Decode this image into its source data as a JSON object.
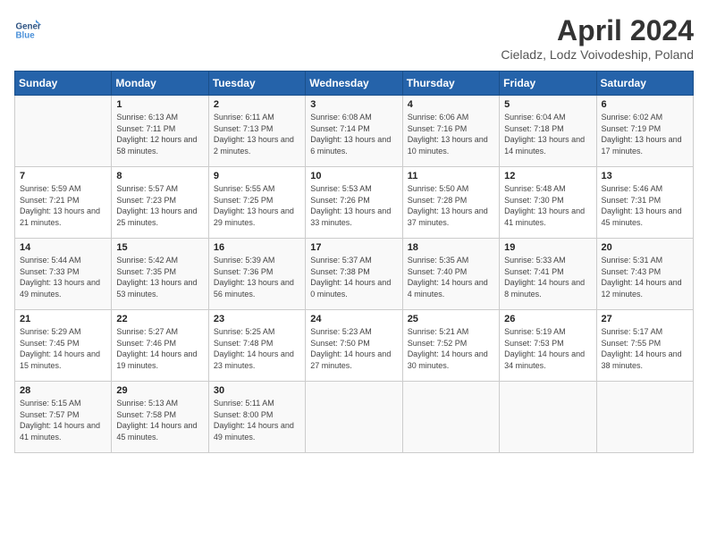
{
  "header": {
    "logo_line1": "General",
    "logo_line2": "Blue",
    "title": "April 2024",
    "location": "Cieladz, Lodz Voivodeship, Poland"
  },
  "days_of_week": [
    "Sunday",
    "Monday",
    "Tuesday",
    "Wednesday",
    "Thursday",
    "Friday",
    "Saturday"
  ],
  "weeks": [
    [
      {
        "day": "",
        "sunrise": "",
        "sunset": "",
        "daylight": ""
      },
      {
        "day": "1",
        "sunrise": "Sunrise: 6:13 AM",
        "sunset": "Sunset: 7:11 PM",
        "daylight": "Daylight: 12 hours and 58 minutes."
      },
      {
        "day": "2",
        "sunrise": "Sunrise: 6:11 AM",
        "sunset": "Sunset: 7:13 PM",
        "daylight": "Daylight: 13 hours and 2 minutes."
      },
      {
        "day": "3",
        "sunrise": "Sunrise: 6:08 AM",
        "sunset": "Sunset: 7:14 PM",
        "daylight": "Daylight: 13 hours and 6 minutes."
      },
      {
        "day": "4",
        "sunrise": "Sunrise: 6:06 AM",
        "sunset": "Sunset: 7:16 PM",
        "daylight": "Daylight: 13 hours and 10 minutes."
      },
      {
        "day": "5",
        "sunrise": "Sunrise: 6:04 AM",
        "sunset": "Sunset: 7:18 PM",
        "daylight": "Daylight: 13 hours and 14 minutes."
      },
      {
        "day": "6",
        "sunrise": "Sunrise: 6:02 AM",
        "sunset": "Sunset: 7:19 PM",
        "daylight": "Daylight: 13 hours and 17 minutes."
      }
    ],
    [
      {
        "day": "7",
        "sunrise": "Sunrise: 5:59 AM",
        "sunset": "Sunset: 7:21 PM",
        "daylight": "Daylight: 13 hours and 21 minutes."
      },
      {
        "day": "8",
        "sunrise": "Sunrise: 5:57 AM",
        "sunset": "Sunset: 7:23 PM",
        "daylight": "Daylight: 13 hours and 25 minutes."
      },
      {
        "day": "9",
        "sunrise": "Sunrise: 5:55 AM",
        "sunset": "Sunset: 7:25 PM",
        "daylight": "Daylight: 13 hours and 29 minutes."
      },
      {
        "day": "10",
        "sunrise": "Sunrise: 5:53 AM",
        "sunset": "Sunset: 7:26 PM",
        "daylight": "Daylight: 13 hours and 33 minutes."
      },
      {
        "day": "11",
        "sunrise": "Sunrise: 5:50 AM",
        "sunset": "Sunset: 7:28 PM",
        "daylight": "Daylight: 13 hours and 37 minutes."
      },
      {
        "day": "12",
        "sunrise": "Sunrise: 5:48 AM",
        "sunset": "Sunset: 7:30 PM",
        "daylight": "Daylight: 13 hours and 41 minutes."
      },
      {
        "day": "13",
        "sunrise": "Sunrise: 5:46 AM",
        "sunset": "Sunset: 7:31 PM",
        "daylight": "Daylight: 13 hours and 45 minutes."
      }
    ],
    [
      {
        "day": "14",
        "sunrise": "Sunrise: 5:44 AM",
        "sunset": "Sunset: 7:33 PM",
        "daylight": "Daylight: 13 hours and 49 minutes."
      },
      {
        "day": "15",
        "sunrise": "Sunrise: 5:42 AM",
        "sunset": "Sunset: 7:35 PM",
        "daylight": "Daylight: 13 hours and 53 minutes."
      },
      {
        "day": "16",
        "sunrise": "Sunrise: 5:39 AM",
        "sunset": "Sunset: 7:36 PM",
        "daylight": "Daylight: 13 hours and 56 minutes."
      },
      {
        "day": "17",
        "sunrise": "Sunrise: 5:37 AM",
        "sunset": "Sunset: 7:38 PM",
        "daylight": "Daylight: 14 hours and 0 minutes."
      },
      {
        "day": "18",
        "sunrise": "Sunrise: 5:35 AM",
        "sunset": "Sunset: 7:40 PM",
        "daylight": "Daylight: 14 hours and 4 minutes."
      },
      {
        "day": "19",
        "sunrise": "Sunrise: 5:33 AM",
        "sunset": "Sunset: 7:41 PM",
        "daylight": "Daylight: 14 hours and 8 minutes."
      },
      {
        "day": "20",
        "sunrise": "Sunrise: 5:31 AM",
        "sunset": "Sunset: 7:43 PM",
        "daylight": "Daylight: 14 hours and 12 minutes."
      }
    ],
    [
      {
        "day": "21",
        "sunrise": "Sunrise: 5:29 AM",
        "sunset": "Sunset: 7:45 PM",
        "daylight": "Daylight: 14 hours and 15 minutes."
      },
      {
        "day": "22",
        "sunrise": "Sunrise: 5:27 AM",
        "sunset": "Sunset: 7:46 PM",
        "daylight": "Daylight: 14 hours and 19 minutes."
      },
      {
        "day": "23",
        "sunrise": "Sunrise: 5:25 AM",
        "sunset": "Sunset: 7:48 PM",
        "daylight": "Daylight: 14 hours and 23 minutes."
      },
      {
        "day": "24",
        "sunrise": "Sunrise: 5:23 AM",
        "sunset": "Sunset: 7:50 PM",
        "daylight": "Daylight: 14 hours and 27 minutes."
      },
      {
        "day": "25",
        "sunrise": "Sunrise: 5:21 AM",
        "sunset": "Sunset: 7:52 PM",
        "daylight": "Daylight: 14 hours and 30 minutes."
      },
      {
        "day": "26",
        "sunrise": "Sunrise: 5:19 AM",
        "sunset": "Sunset: 7:53 PM",
        "daylight": "Daylight: 14 hours and 34 minutes."
      },
      {
        "day": "27",
        "sunrise": "Sunrise: 5:17 AM",
        "sunset": "Sunset: 7:55 PM",
        "daylight": "Daylight: 14 hours and 38 minutes."
      }
    ],
    [
      {
        "day": "28",
        "sunrise": "Sunrise: 5:15 AM",
        "sunset": "Sunset: 7:57 PM",
        "daylight": "Daylight: 14 hours and 41 minutes."
      },
      {
        "day": "29",
        "sunrise": "Sunrise: 5:13 AM",
        "sunset": "Sunset: 7:58 PM",
        "daylight": "Daylight: 14 hours and 45 minutes."
      },
      {
        "day": "30",
        "sunrise": "Sunrise: 5:11 AM",
        "sunset": "Sunset: 8:00 PM",
        "daylight": "Daylight: 14 hours and 49 minutes."
      },
      {
        "day": "",
        "sunrise": "",
        "sunset": "",
        "daylight": ""
      },
      {
        "day": "",
        "sunrise": "",
        "sunset": "",
        "daylight": ""
      },
      {
        "day": "",
        "sunrise": "",
        "sunset": "",
        "daylight": ""
      },
      {
        "day": "",
        "sunrise": "",
        "sunset": "",
        "daylight": ""
      }
    ]
  ]
}
